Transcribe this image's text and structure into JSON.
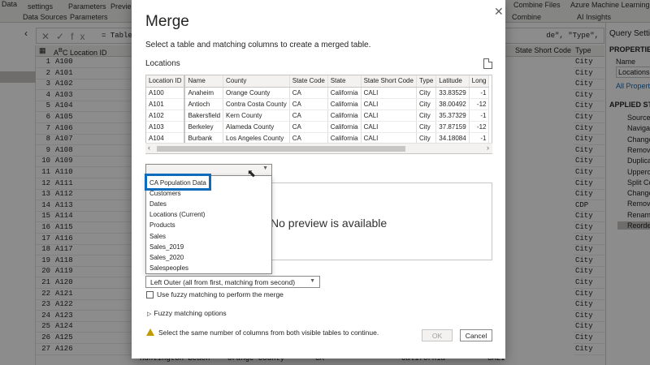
{
  "ribbon": {
    "items": [
      "Data",
      "settings",
      "Parameters",
      "Previe",
      "Combine Files",
      "Azure Machine Learning",
      "Data Sources",
      "Parameters",
      "Combine",
      "AI Insights"
    ]
  },
  "formula": {
    "fx": "fx",
    "text_left": "= Table",
    "text_right": "de\", \"Type\","
  },
  "grid": {
    "header_index": "",
    "header_label": "Location ID",
    "rows": [
      {
        "n": "1",
        "v": "A100"
      },
      {
        "n": "2",
        "v": "A101"
      },
      {
        "n": "3",
        "v": "A102"
      },
      {
        "n": "4",
        "v": "A103"
      },
      {
        "n": "5",
        "v": "A104"
      },
      {
        "n": "6",
        "v": "A105"
      },
      {
        "n": "7",
        "v": "A106"
      },
      {
        "n": "8",
        "v": "A107"
      },
      {
        "n": "9",
        "v": "A108"
      },
      {
        "n": "10",
        "v": "A109"
      },
      {
        "n": "11",
        "v": "A110"
      },
      {
        "n": "12",
        "v": "A111"
      },
      {
        "n": "13",
        "v": "A112"
      },
      {
        "n": "14",
        "v": "A113"
      },
      {
        "n": "15",
        "v": "A114"
      },
      {
        "n": "16",
        "v": "A115"
      },
      {
        "n": "17",
        "v": "A116"
      },
      {
        "n": "18",
        "v": "A117"
      },
      {
        "n": "19",
        "v": "A118"
      },
      {
        "n": "20",
        "v": "A119"
      },
      {
        "n": "21",
        "v": "A120"
      },
      {
        "n": "22",
        "v": "A121"
      },
      {
        "n": "23",
        "v": "A122"
      },
      {
        "n": "24",
        "v": "A123"
      },
      {
        "n": "25",
        "v": "A124"
      },
      {
        "n": "26",
        "v": "A125"
      },
      {
        "n": "27",
        "v": "A126"
      }
    ],
    "right_header_code": "State Short Code",
    "right_header_type": "Type",
    "right_cells": [
      "City",
      "City",
      "City",
      "City",
      "City",
      "City",
      "City",
      "City",
      "City",
      "City",
      "City",
      "City",
      "City",
      "CDP",
      "City",
      "City",
      "City",
      "City",
      "City",
      "City",
      "City",
      "City",
      "City",
      "City",
      "City",
      "City",
      "City"
    ]
  },
  "bottom_row": [
    "Huntington Beach",
    "Orange County",
    "CA",
    "California",
    "CALI"
  ],
  "settings": {
    "title": "Query Setting",
    "properties": "PROPERTIE",
    "name_label": "Name",
    "name_value": "Locations",
    "all_properties": "All Propertie",
    "applied_steps": "APPLIED ST",
    "steps": [
      "Source",
      "Navigat",
      "Change",
      "Remove",
      "Duplica",
      "Upperca",
      "Split Co",
      "Change",
      "Remove",
      "Rename",
      "Reorde"
    ]
  },
  "dialog": {
    "title": "Merge",
    "subtitle": "Select a table and matching columns to create a merged table.",
    "table_name": "Locations",
    "columns": [
      "Location ID",
      "Name",
      "County",
      "State Code",
      "State",
      "State Short Code",
      "Type",
      "Latitude",
      "Long"
    ],
    "rows": [
      [
        "A100",
        "Anaheim",
        "Orange County",
        "CA",
        "California",
        "CALI",
        "City",
        "33.83529",
        "-1"
      ],
      [
        "A101",
        "Antioch",
        "Contra Costa County",
        "CA",
        "California",
        "CALI",
        "City",
        "38.00492",
        "-12"
      ],
      [
        "A102",
        "Bakersfield",
        "Kern County",
        "CA",
        "California",
        "CALI",
        "City",
        "35.37329",
        "-1"
      ],
      [
        "A103",
        "Berkeley",
        "Alameda County",
        "CA",
        "California",
        "CALI",
        "City",
        "37.87159",
        "-12"
      ],
      [
        "A104",
        "Burbank",
        "Los Angeles County",
        "CA",
        "California",
        "CALI",
        "City",
        "34.18084",
        "-1"
      ]
    ],
    "second_table_value": "",
    "dropdown_items": [
      "CA Population Data",
      "Customers",
      "Dates",
      "Locations (Current)",
      "Products",
      "Sales",
      "Sales_2019",
      "Sales_2020",
      "Salespeoples"
    ],
    "no_preview": "No preview is available",
    "join_kind": "Left Outer (all from first, matching from second)",
    "fuzzy_label": "Use fuzzy matching to perform the merge",
    "fuzzy_options": "Fuzzy matching options",
    "warning": "Select the same number of columns from both visible tables to continue.",
    "ok": "OK",
    "cancel": "Cancel"
  },
  "colors": {
    "accent": "#0f6cbd",
    "warning": "#c19c00"
  }
}
